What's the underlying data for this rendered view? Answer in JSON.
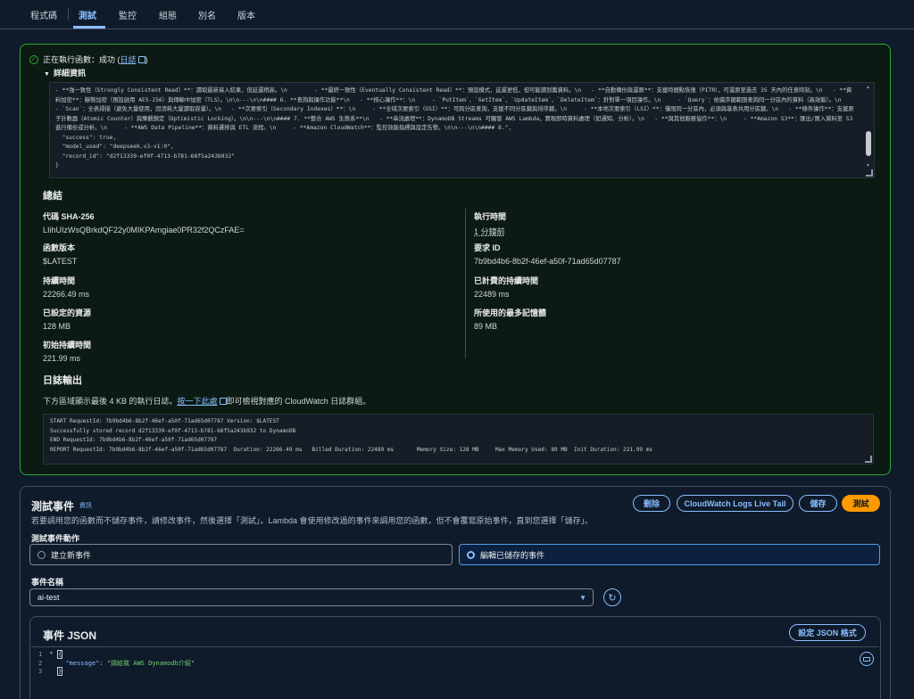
{
  "tabs": [
    {
      "label": "程式碼"
    },
    {
      "label": "測試"
    },
    {
      "label": "監控"
    },
    {
      "label": "組態"
    },
    {
      "label": "別名"
    },
    {
      "label": "版本"
    }
  ],
  "result": {
    "status_prefix": "正在執行函數：成功 (",
    "log_link": "日誌",
    "status_suffix": ")",
    "details_label": "詳細資訊",
    "code_output": "- **強一致性（Strongly Consistent Read）**：讀取最新寫入結果，但延遲稍高。\\n        - **最終一致性（Eventually Consistent Read）**：預設模式，延遲更低，但可能讀到舊資料。\\n   - **自動備份與還原**：支援時間點恢復（PITR），可還原至過去 35 天內的任意時刻。\\n   - **資料加密**：靜態加密（預設啟用 AES-256）與傳輸中加密（TLS）。\\n\\n---\\n\\n#### 6. **查詢與操作功能**\\n   - **核心操作**：\\n     - `PutItem`、`GetItem`、`UpdateItem`、`DeleteItem`：針對單一項目操作。\\n     - `Query`：依據序鍵範圍查詢同一分區內的資料（高效能）。\\n     - `Scan`：全表掃描（避免大量使用，因消耗大量讀取容量）。\\n   - **次要索引（Secondary Indexes）**：\\n     - **全域次要索引（GSI）**：可跨分區查詢，支援不同分區鍵與排序鍵。\\n     - **本地次要索引（LSI）**：僅限同一分區內，必須與基表共用分區鍵。\\n   - **條件操作**：支援原子計數器（Atomic Counter）與樂觀鎖定（Optimistic Locking）。\\n\\n---\\n\\n#### 7. **整合 AWS 生態系**\\n   - **串流處理**：DynamoDB Streams 可觸發 AWS Lambda，實現即時資料處理（如通知、分析）。\\n   - **與其他服務協作**：\\n     - **Amazon S3**：匯出/匯入資料至 S3 進行備份或分析。\\n     - **AWS Data Pipeline**：資料遷移與 ETL 流程。\\n     - **Amazon CloudWatch**：監控效能指標與設定告警。\\n\\n---\\n\\n#### 8.\",\n  \"success\": true,\n  \"model_used\": \"deepseek.v3-v1:0\",\n  \"record_id\": \"d2f13339-ef0f-4713-b781-68f5a243b932\"\n}"
  },
  "summary": {
    "title": "總結",
    "code_sha_label": "代碼 SHA-256",
    "code_sha_value": "LIihUIzWsQBrkdQF22y0MIKPAmgiae0PR32f2QCzFAE=",
    "exec_time_label": "執行時間",
    "exec_time_value": "1 分鐘前",
    "func_version_label": "函數版本",
    "func_version_value": "$LATEST",
    "request_id_label": "要求 ID",
    "request_id_value": "7b9bd4b6-8b2f-46ef-a50f-71ad65d07787",
    "duration_label": "持續時間",
    "duration_value": "22266.49 ms",
    "billed_label": "已計費的持續時間",
    "billed_value": "22489 ms",
    "resources_label": "已設定的資源",
    "resources_value": "128 MB",
    "max_mem_label": "所使用的最多記憶體",
    "max_mem_value": "89 MB",
    "init_label": "初始持續時間",
    "init_value": "221.99 ms"
  },
  "log": {
    "title": "日誌輸出",
    "desc_prefix": "下方區域顯示最後 4 KB 的執行日誌。",
    "desc_link": "按一下此處",
    "desc_suffix": "即可檢視對應的 CloudWatch 日誌群組。",
    "lines": "START RequestId: 7b9bd4b6-8b2f-46ef-a50f-71ad65d07787 Version: $LATEST\nSuccessfully stored record d2f13339-ef0f-4713-b781-68f5a243b932 to DynamoDB\nEND RequestId: 7b9bd4b6-8b2f-46ef-a50f-71ad65d07787\nREPORT RequestId: 7b9bd4b6-8b2f-46ef-a50f-71ad65d07787  Duration: 22266.49 ms   Billed Duration: 22489 ms       Memory Size: 128 MB     Max Memory Used: 89 MB  Init Duration: 221.99 ms"
  },
  "test_event": {
    "title": "測試事件",
    "info": "資訊",
    "desc": "若要調用您的函數而不儲存事件，請修改事件，然後選擇「測試」。Lambda 會使用修改過的事件來調用您的函數，但不會覆寫原始事件，直到您選擇「儲存」。",
    "delete_label": "刪除",
    "cloudwatch_label": "CloudWatch Logs Live Tail",
    "save_label": "儲存",
    "test_label": "測試",
    "action_label": "測試事件動作",
    "option_new": "建立新事件",
    "option_edit": "編輯已儲存的事件",
    "name_label": "事件名稱",
    "name_value": "ai-test",
    "json_title": "事件 JSON",
    "format_label": "設定 JSON 格式",
    "json_key": "\"message\"",
    "json_value": "\"請給我 AWS Dynamodb介紹\""
  }
}
